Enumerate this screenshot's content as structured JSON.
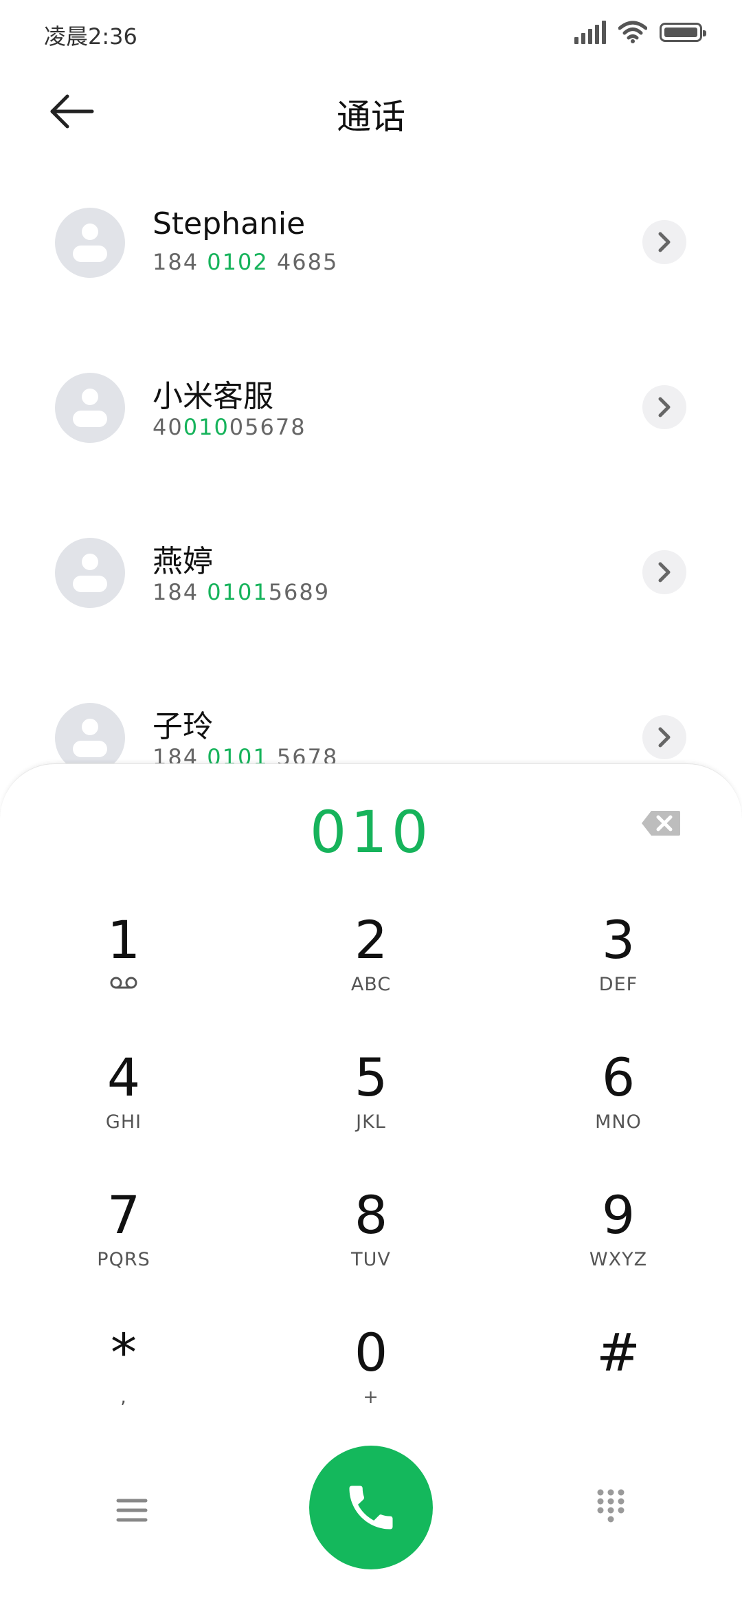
{
  "status": {
    "time": "凌晨2:36"
  },
  "header": {
    "title": "通话"
  },
  "results": [
    {
      "name": "Stephanie",
      "number_pre": "184 ",
      "number_match": "0102",
      "number_post": " 4685"
    },
    {
      "name": "小米客服",
      "number_pre": "40",
      "number_match": "010",
      "number_post": "05678"
    },
    {
      "name": "燕婷",
      "number_pre": "184 ",
      "number_match": "0101",
      "number_post": "5689"
    },
    {
      "name": "子玲",
      "number_pre": "184 ",
      "number_match": "0101",
      "number_post": " 5678"
    }
  ],
  "dialpad": {
    "input": "010",
    "keys": [
      {
        "digit": "1",
        "letters": "",
        "icon": "voicemail-icon"
      },
      {
        "digit": "2",
        "letters": "ABC"
      },
      {
        "digit": "3",
        "letters": "DEF"
      },
      {
        "digit": "4",
        "letters": "GHI"
      },
      {
        "digit": "5",
        "letters": "JKL"
      },
      {
        "digit": "6",
        "letters": "MNO"
      },
      {
        "digit": "7",
        "letters": "PQRS"
      },
      {
        "digit": "8",
        "letters": "TUV"
      },
      {
        "digit": "9",
        "letters": "WXYZ"
      },
      {
        "digit": "*",
        "letters": ","
      },
      {
        "digit": "0",
        "letters": "+"
      },
      {
        "digit": "#",
        "letters": ""
      }
    ]
  },
  "colors": {
    "accent": "#16b35b",
    "call_button": "#14b85c"
  },
  "icons": [
    "back-arrow-icon",
    "chevron-right-icon",
    "backspace-icon",
    "menu-icon",
    "phone-icon",
    "keypad-icon"
  ]
}
